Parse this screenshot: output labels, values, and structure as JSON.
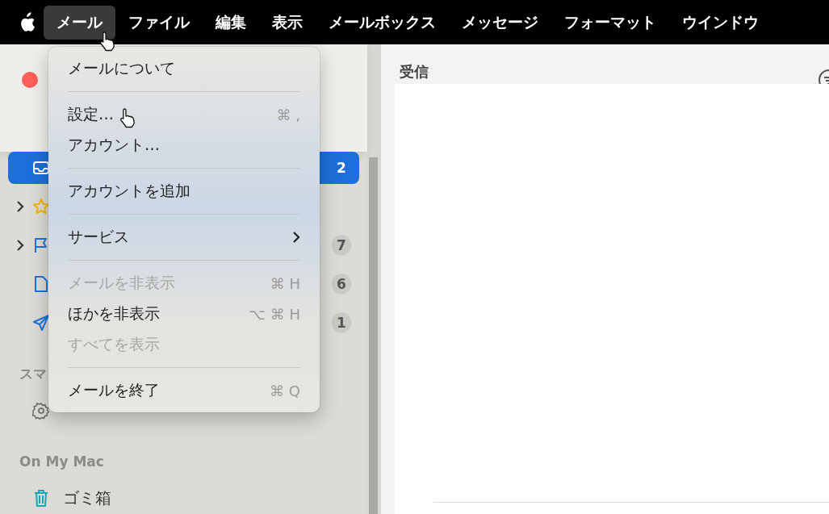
{
  "menu_bar": {
    "items": [
      {
        "label": "メール",
        "selected": true
      },
      {
        "label": "ファイル",
        "selected": false
      },
      {
        "label": "編集",
        "selected": false
      },
      {
        "label": "表示",
        "selected": false
      },
      {
        "label": "メールボックス",
        "selected": false
      },
      {
        "label": "メッセージ",
        "selected": false
      },
      {
        "label": "フォーマット",
        "selected": false
      },
      {
        "label": "ウインドウ",
        "selected": false
      }
    ]
  },
  "menu": {
    "items": [
      {
        "kind": "item",
        "label": "メールについて",
        "disabled": false
      },
      {
        "kind": "separator"
      },
      {
        "kind": "item",
        "label": "設定…",
        "shortcut": "⌘ ,",
        "disabled": false
      },
      {
        "kind": "item",
        "label": "アカウント…",
        "disabled": false
      },
      {
        "kind": "separator"
      },
      {
        "kind": "item",
        "label": "アカウントを追加",
        "disabled": false
      },
      {
        "kind": "separator"
      },
      {
        "kind": "item",
        "label": "サービス",
        "disabled": false,
        "submenu": true
      },
      {
        "kind": "separator"
      },
      {
        "kind": "item",
        "label": "メールを非表示",
        "shortcut": "⌘ H",
        "disabled": true
      },
      {
        "kind": "item",
        "label": "ほかを非表示",
        "shortcut": "⌥ ⌘ H",
        "disabled": false
      },
      {
        "kind": "item",
        "label": "すべてを表示",
        "disabled": true
      },
      {
        "kind": "separator"
      },
      {
        "kind": "item",
        "label": "メールを終了",
        "shortcut": "⌘ Q",
        "disabled": false
      }
    ]
  },
  "sidebar": {
    "mailboxes": [
      {
        "kind": "inbox",
        "badge": "2",
        "selected": true
      },
      {
        "kind": "star",
        "expanded": false,
        "selected": false
      },
      {
        "kind": "flag",
        "expanded": false,
        "badge": "7",
        "selected": false
      },
      {
        "kind": "document",
        "badge": "6",
        "selected": false
      },
      {
        "kind": "send",
        "badge": "1",
        "selected": false
      }
    ],
    "sections": [
      {
        "heading": "スマ",
        "items": [
          {
            "kind": "gear"
          }
        ]
      },
      {
        "heading": "On My Mac",
        "items": [
          {
            "kind": "trash",
            "label": "ゴミ箱"
          }
        ]
      }
    ]
  },
  "content": {
    "title": "受信"
  }
}
